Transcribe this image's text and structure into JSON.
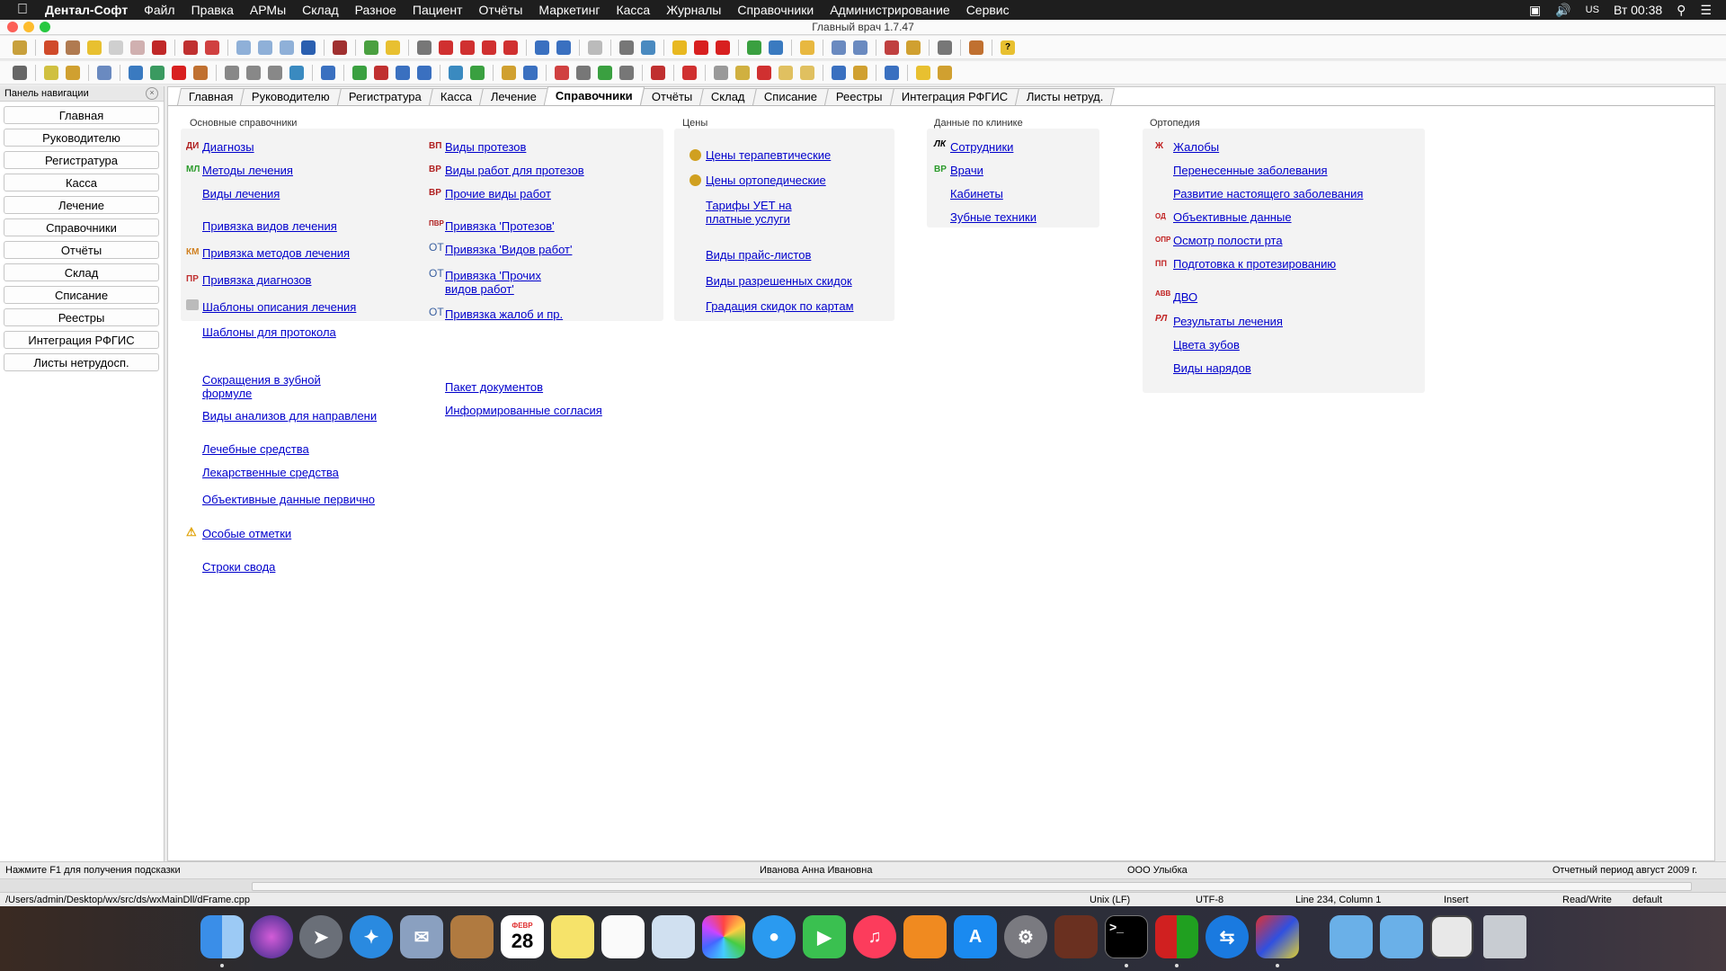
{
  "menubar": {
    "app_name": "Дентал-Софт",
    "items": [
      "Файл",
      "Правка",
      "АРМы",
      "Склад",
      "Разное",
      "Пациент",
      "Отчёты",
      "Маркетинг",
      "Касса",
      "Журналы",
      "Справочники",
      "Администрирование",
      "Сервис"
    ],
    "clock": "Вт 00:38",
    "input_lang": "US"
  },
  "window": {
    "title": "Главный врач 1.7.47"
  },
  "nav_panel": {
    "title": "Панель навигации",
    "buttons": [
      "Главная",
      "Руководителю",
      "Регистратура",
      "Касса",
      "Лечение",
      "Справочники",
      "Отчёты",
      "Склад",
      "Списание",
      "Реестры",
      "Интеграция РФГИС",
      "Листы нетрудосп."
    ]
  },
  "tabs": {
    "items": [
      "Главная",
      "Руководителю",
      "Регистратура",
      "Касса",
      "Лечение",
      "Справочники",
      "Отчёты",
      "Склад",
      "Списание",
      "Реестры",
      "Интеграция РФГИС",
      "Листы нетруд."
    ],
    "active": "Справочники"
  },
  "groups": {
    "basic": {
      "title": "Основные справочники",
      "col1": [
        {
          "icon": "ДИ",
          "label": "Диагнозы"
        },
        {
          "icon": "МЛ",
          "label": "Методы лечения"
        },
        {
          "icon": "",
          "label": "Виды лечения"
        },
        {
          "icon": "",
          "label": "Привязка видов лечения"
        },
        {
          "icon": "КМ",
          "label": "Привязка методов лечения"
        },
        {
          "icon": "ПР",
          "label": "Привязка диагнозов"
        },
        {
          "icon": "box",
          "label": "Шаблоны описания лечения"
        },
        {
          "icon": "",
          "label": "Шаблоны для протокола"
        }
      ],
      "col2": [
        {
          "icon": "ВП",
          "label": "Виды протезов"
        },
        {
          "icon": "ВР",
          "label": "Виды работ для протезов"
        },
        {
          "icon": "ВР",
          "label": "Прочие виды работ"
        },
        {
          "icon": "ПВР",
          "label": "Привязка 'Протезов'"
        },
        {
          "icon": "ОТ",
          "label": "Привязка 'Видов работ'"
        },
        {
          "icon": "ОТ",
          "label": "Привязка 'Прочих видов работ'"
        },
        {
          "icon": "ОТ",
          "label": "Привязка жалоб и пр."
        }
      ]
    },
    "extra_col1": [
      {
        "icon": "",
        "label": "Сокращения в зубной формуле"
      },
      {
        "icon": "",
        "label": "Виды анализов для направлени"
      },
      {
        "icon": "",
        "label": "Лечебные средства"
      },
      {
        "icon": "",
        "label": "Лекарственные средства"
      },
      {
        "icon": "",
        "label": "Объективные данные первично"
      },
      {
        "icon": "warning",
        "label": "Особые отметки"
      },
      {
        "icon": "",
        "label": "Строки свода"
      }
    ],
    "extra_col2": [
      {
        "icon": "",
        "label": "Пакет документов"
      },
      {
        "icon": "",
        "label": "Информированные согласия"
      }
    ],
    "prices": {
      "title": "Цены",
      "items": [
        {
          "icon": "coin",
          "label": "Цены терапевтические"
        },
        {
          "icon": "coin",
          "label": "Цены ортопедические"
        },
        {
          "icon": "",
          "label": "Тарифы УЕТ на платные услуги"
        },
        {
          "icon": "",
          "label": "Виды прайс-листов"
        },
        {
          "icon": "",
          "label": "Виды разрешенных скидок"
        },
        {
          "icon": "",
          "label": "Градация скидок по картам"
        }
      ]
    },
    "clinic": {
      "title": "Данные по клинике",
      "items": [
        {
          "icon": "ЛК",
          "label": "Сотрудники"
        },
        {
          "icon": "ВР",
          "label": "Врачи"
        },
        {
          "icon": "",
          "label": "Кабинеты"
        },
        {
          "icon": "",
          "label": "Зубные техники"
        }
      ]
    },
    "ortho": {
      "title": "Ортопедия",
      "items": [
        {
          "icon": "Ж",
          "label": "Жалобы"
        },
        {
          "icon": "",
          "label": "Перенесенные заболевания"
        },
        {
          "icon": "",
          "label": "Развитие настоящего заболевания"
        },
        {
          "icon": "ОД",
          "label": "Объективные данные"
        },
        {
          "icon": "ОПР",
          "label": "Осмотр полости рта"
        },
        {
          "icon": "ПП",
          "label": "Подготовка к протезированию"
        },
        {
          "icon": "АВВ",
          "label": "ДВО"
        },
        {
          "icon": "РЛ",
          "label": "Результаты лечения"
        },
        {
          "icon": "",
          "label": "Цвета зубов"
        },
        {
          "icon": "",
          "label": "Виды нарядов"
        }
      ]
    }
  },
  "status": {
    "hint": "Нажмите F1 для получения подсказки",
    "user": "Иванова Анна Ивановна",
    "org": "ООО Улыбка",
    "period": "Отчетный период август 2009 г."
  },
  "pathbar": {
    "path": "/Users/admin/Desktop/wx/src/ds/wxMainDll/dFrame.cpp",
    "eol": "Unix (LF)",
    "encoding": "UTF-8",
    "position": "Line 234, Column 1",
    "mode": "Insert",
    "access": "Read/Write",
    "scheme": "default"
  },
  "dock": {
    "calendar_month": "ФЕВР",
    "calendar_day": "28"
  },
  "colors": {
    "link": "#0000cc",
    "menubar": "#1e1e1e",
    "group_bg": "#f3f3f3"
  }
}
